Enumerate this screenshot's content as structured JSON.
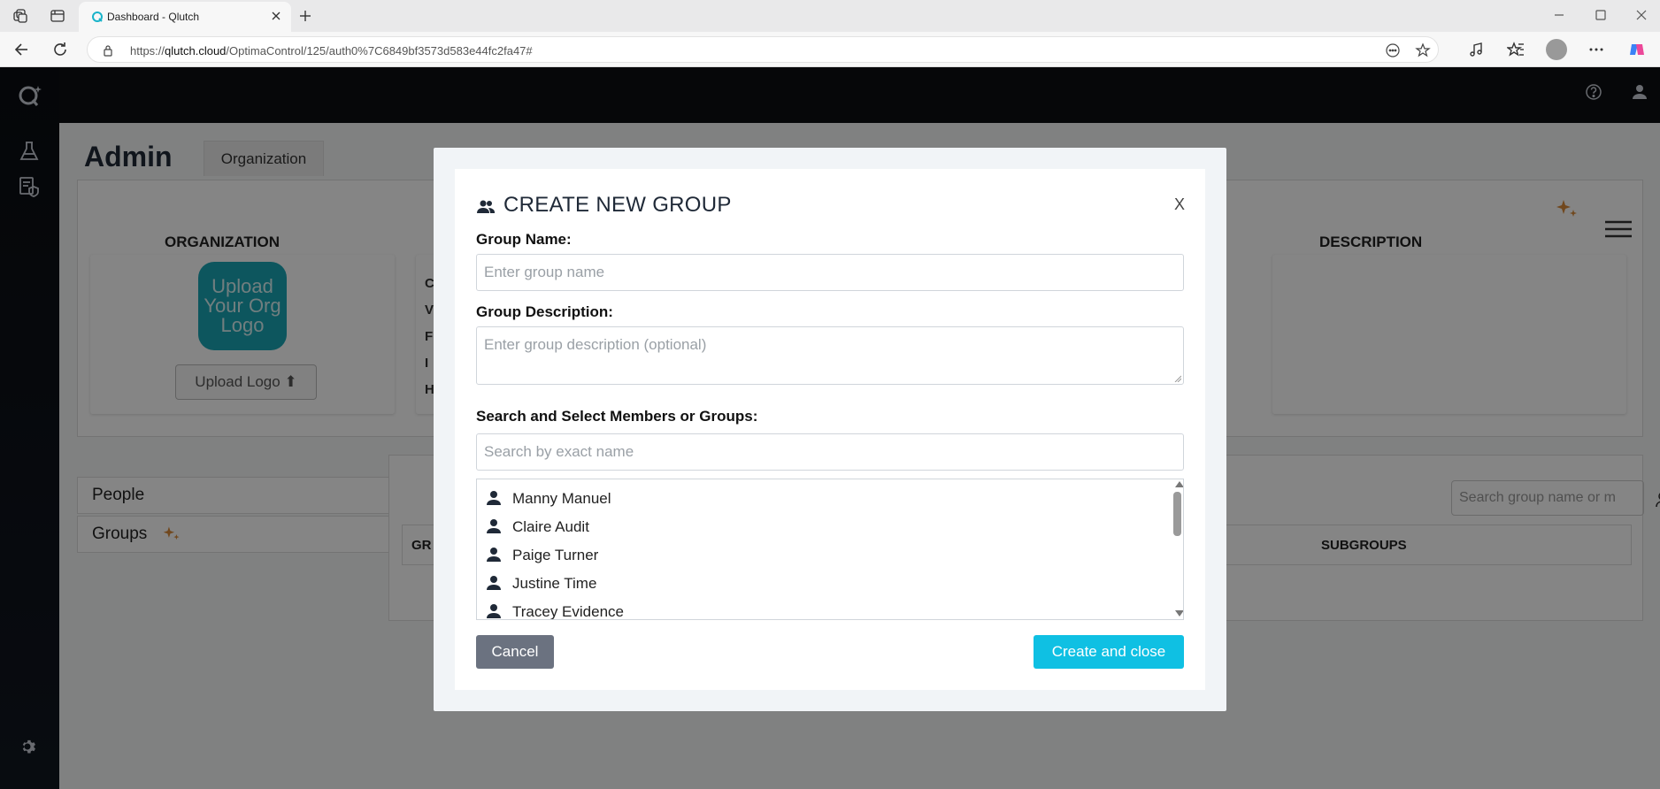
{
  "browser": {
    "tab_title": "Dashboard - Qlutch",
    "url_host": "qlutch.cloud",
    "url_prefix": "https://",
    "url_path": "/OptimaControl/125/auth0%7C6849bf3573d583e44fc2fa47#"
  },
  "app": {
    "page_title": "Admin",
    "tabs": [
      {
        "label": "Organization"
      }
    ],
    "org_columns": {
      "organization": "ORGANIZATION",
      "description": "DESCRIPTION"
    },
    "logo_placeholder": "Upload Your Org Logo",
    "upload_logo_label": "Upload Logo",
    "side_list": [
      {
        "label": "People"
      },
      {
        "label": "Groups"
      }
    ],
    "group_search_placeholder": "Search group name or m",
    "group_table_headers": {
      "left": "GR",
      "right": "SUBGROUPS"
    },
    "partial_letters": [
      "C",
      "V",
      "F",
      "I",
      "H"
    ]
  },
  "modal": {
    "title": "CREATE NEW GROUP",
    "close_label": "X",
    "group_name_label": "Group Name:",
    "group_name_placeholder": "Enter group name",
    "group_description_label": "Group Description:",
    "group_description_placeholder": "Enter group description (optional)",
    "search_label": "Search and Select Members or Groups:",
    "search_placeholder": "Search by exact name",
    "members": [
      {
        "name": "Manny Manuel"
      },
      {
        "name": "Claire Audit"
      },
      {
        "name": "Paige Turner"
      },
      {
        "name": "Justine Time"
      },
      {
        "name": "Tracey Evidence"
      }
    ],
    "cancel_label": "Cancel",
    "create_label": "Create and close"
  },
  "colors": {
    "accent": "#0fc0e3",
    "cancel": "#6b7280",
    "logo_bg": "#1aa6b5",
    "sparkle": "#d98b3a",
    "nav_bg": "#0c0f13"
  }
}
